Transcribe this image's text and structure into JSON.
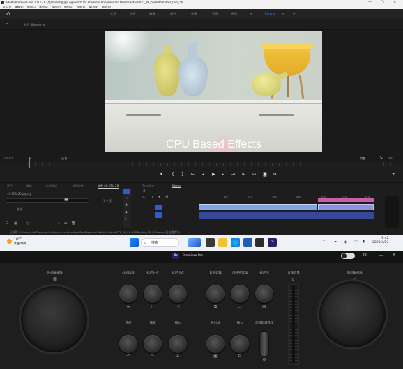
{
  "premiere": {
    "title": "Adobe Premiere Pro 2023 - C:\\用户\\user\\桌面\\LogiBench for Premiere Pro\\Standard Media\\Native\\422_4K_59.94P\\ProRes_CPU_59",
    "window_controls": [
      "—",
      "▢",
      "✕"
    ],
    "menu": [
      "文件(F)",
      "编辑(E)",
      "剪辑(C)",
      "序列(S)",
      "标记(M)",
      "图形(G)",
      "视图(V)",
      "窗口(W)",
      "帮助(H)"
    ],
    "workspace_tabs": [
      "学习",
      "组件",
      "编辑",
      "颜色",
      "效果",
      "音频",
      "图形",
      "库",
      "Editing",
      "≡"
    ],
    "active_workspace": "Editing",
    "program_label": "节目: Edome  ≡",
    "video_caption": "CPU Based Effects",
    "timecode_left": "00;00",
    "zoom_fit": "适合",
    "quality": "完整",
    "timecode_right": "600",
    "panel_tabs": [
      "项目",
      "媒体",
      "信息区域",
      "效果控件",
      "效果 40 CPU 29"
    ],
    "project_file": "40 CPU 29.prproj",
    "items_count": "1 个项",
    "timeline_tab": "Edome",
    "timeline_ticks": [
      "120",
      "240",
      "360",
      "480",
      "600",
      "720",
      "840"
    ],
    "clip1_label": "fx ProRes422 1080 59.94fps.mov [V]",
    "clip2_label": "fx ProRes422 1080 59.94fps.mov",
    "status_text": "已处理 C:\\Users\\sub\\Desktop\\LogiBench for Premiere Pro\\Standard Media\\Native\\422_4K_59.94P\\ProRes_CPU_59.mov (已处理完毕)"
  },
  "taskbar": {
    "weather_temp": "10°C",
    "weather_desc": "大部晴朗",
    "search_placeholder": "搜索",
    "time": "9:42",
    "date": "2023/4/23",
    "tray_icons": [
      "^",
      "wifi",
      "speaker",
      "battery"
    ]
  },
  "console": {
    "app_name": "Premiere Pro",
    "left_dial_label": "时间轴缩放",
    "right_dial_label": "时间轴缩放",
    "top_button_labels": [
      "标记选择",
      "标记入点",
      "标记出点",
      "复制剪辑",
      "创建子剪辑",
      "标记出"
    ],
    "top_fader_label": "音频音量",
    "fader_top_value": "0",
    "bottom_labels": [
      "选择",
      "撤销",
      "插入",
      "导出帧",
      "插入",
      "音频轨道选择"
    ],
    "icons": [
      "gear-icon",
      "minimize-icon",
      "close-icon"
    ]
  }
}
